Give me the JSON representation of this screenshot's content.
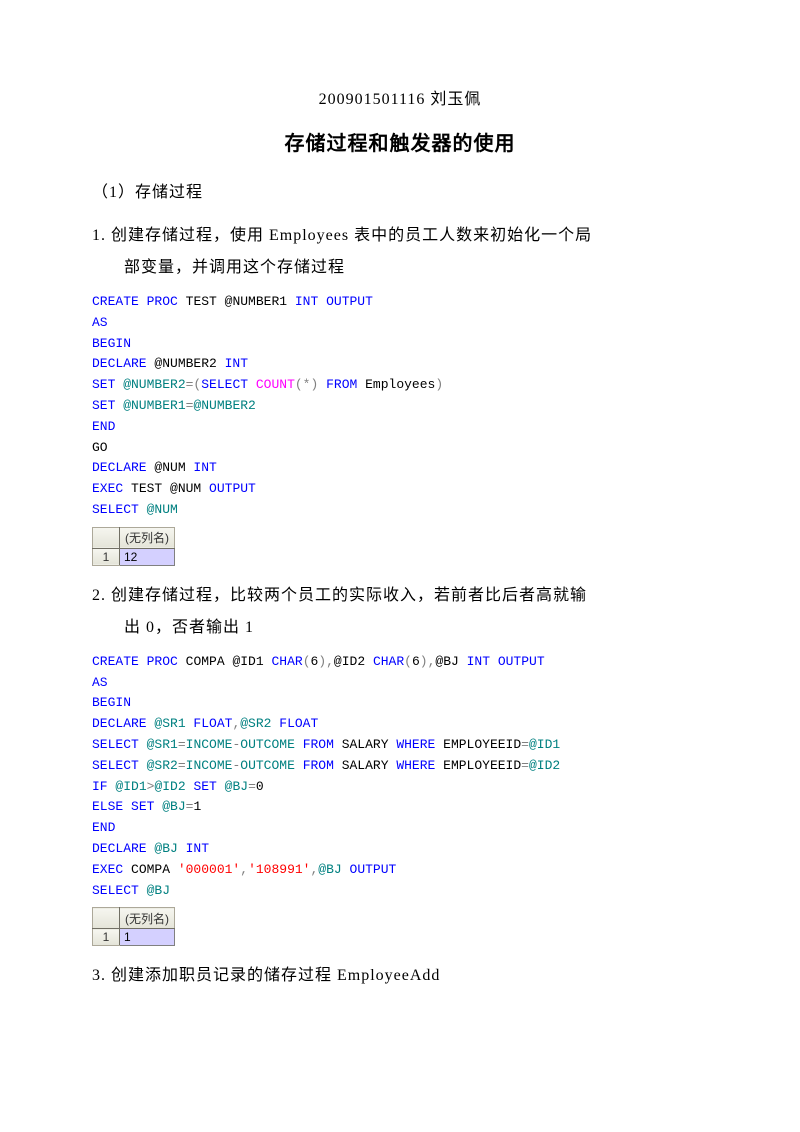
{
  "header_id": "200901501116 刘玉佩",
  "title": "存储过程和触发器的使用",
  "section_label": "（1）存储过程",
  "task1": {
    "line1": "1. 创建存储过程，使用 Employees 表中的员工人数来初始化一个局",
    "line2": "部变量，并调用这个存储过程"
  },
  "code1": {
    "l1_a": "CREATE",
    "l1_b": "PROC",
    "l1_c": " TEST @NUMBER1 ",
    "l1_d": "INT",
    "l1_e": "OUTPUT",
    "l2": "AS",
    "l3": "BEGIN",
    "l4_a": "DECLARE",
    "l4_b": " @NUMBER2 ",
    "l4_c": "INT",
    "l5_a": "SET",
    "l5_b": " @NUMBER2",
    "l5_c": "=(",
    "l5_d": "SELECT",
    "l5_e": "COUNT",
    "l5_f": "(*)",
    "l5_g": "FROM",
    "l5_h": " Employees",
    "l5_i": ")",
    "l6_a": "SET",
    "l6_b": " @NUMBER1",
    "l6_c": "=",
    "l6_d": "@NUMBER2",
    "l7": "END",
    "l8": "GO",
    "l9_a": "DECLARE",
    "l9_b": " @NUM ",
    "l9_c": "INT",
    "l10_a": "EXEC",
    "l10_b": " TEST @NUM ",
    "l10_c": "OUTPUT",
    "l11_a": "SELECT",
    "l11_b": " @NUM"
  },
  "result1": {
    "header": "(无列名)",
    "row": "1",
    "val": "12"
  },
  "task2": {
    "line1": "2. 创建存储过程，比较两个员工的实际收入，若前者比后者高就输",
    "line2": "出 0，否者输出 1"
  },
  "code2": {
    "l1_a": "CREATE",
    "l1_b": "PROC",
    "l1_c": " COMPA @ID1 ",
    "l1_d": "CHAR",
    "l1_e": "(",
    "l1_f": "6",
    "l1_g": "),",
    "l1_h": "@ID2 ",
    "l1_i": "CHAR",
    "l1_j": "(",
    "l1_k": "6",
    "l1_l": "),",
    "l1_m": "@BJ ",
    "l1_n": "INT",
    "l1_o": "OUTPUT",
    "l2": "AS",
    "l3": "BEGIN",
    "l4_a": "DECLARE",
    "l4_b": " @SR1 ",
    "l4_c": "FLOAT",
    "l4_d": ",",
    "l4_e": "@SR2 ",
    "l4_f": "FLOAT",
    "l5_a": "SELECT",
    "l5_b": " @SR1",
    "l5_c": "=",
    "l5_d": "INCOME",
    "l5_e": "-",
    "l5_f": "OUTCOME ",
    "l5_g": "FROM",
    "l5_h": " SALARY ",
    "l5_i": "WHERE",
    "l5_j": " EMPLOYEEID",
    "l5_k": "=",
    "l5_l": "@ID1",
    "l6_a": "SELECT",
    "l6_b": " @SR2",
    "l6_c": "=",
    "l6_d": "INCOME",
    "l6_e": "-",
    "l6_f": "OUTCOME ",
    "l6_g": "FROM",
    "l6_h": " SALARY ",
    "l6_i": "WHERE",
    "l6_j": " EMPLOYEEID",
    "l6_k": "=",
    "l6_l": "@ID2",
    "l7_a": "IF",
    "l7_b": " @ID1",
    "l7_c": ">",
    "l7_d": "@ID2 ",
    "l7_e": "SET",
    "l7_f": " @BJ",
    "l7_g": "=",
    "l7_h": "0",
    "l8_a": "ELSE",
    "l8_b": "SET",
    "l8_c": " @BJ",
    "l8_d": "=",
    "l8_e": "1",
    "l9": "END",
    "l10_a": "DECLARE",
    "l10_b": " @BJ ",
    "l10_c": "INT",
    "l11_a": "EXEC",
    "l11_b": " COMPA ",
    "l11_c": "'000001'",
    "l11_d": ",",
    "l11_e": "'108991'",
    "l11_f": ",",
    "l11_g": "@BJ ",
    "l11_h": "OUTPUT",
    "l12_a": "SELECT",
    "l12_b": " @BJ"
  },
  "result2": {
    "header": "(无列名)",
    "row": "1",
    "val": "1"
  },
  "task3": "3. 创建添加职员记录的储存过程 EmployeeAdd"
}
